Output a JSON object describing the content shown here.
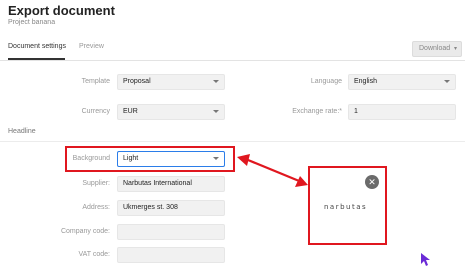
{
  "header": {
    "title": "Export document",
    "subtitle": "Project banana"
  },
  "tabs": [
    {
      "label": "Document settings",
      "active": true
    },
    {
      "label": "Preview",
      "active": false
    }
  ],
  "toolbar": {
    "download_label": "Download",
    "download_caret": "▾"
  },
  "settings": {
    "template": {
      "label": "Template",
      "value": "Proposal"
    },
    "language": {
      "label": "Language",
      "value": "English"
    },
    "currency": {
      "label": "Currency",
      "value": "EUR"
    },
    "exchange_rate": {
      "label": "Exchange rate:*",
      "value": "1"
    }
  },
  "headline": {
    "section_title": "Headline",
    "background": {
      "label": "Background",
      "value": "Light"
    },
    "supplier": {
      "label": "Supplier:",
      "value": "Narbutas International"
    },
    "address": {
      "label": "Address:",
      "value": "Ukmerges st. 308"
    },
    "company_code": {
      "label": "Company code:",
      "value": ""
    },
    "vat_code": {
      "label": "VAT code:",
      "value": ""
    }
  },
  "preview": {
    "logo_text": "narbutas",
    "close_glyph": "✕"
  },
  "colors": {
    "highlight": "#e0171f",
    "focus": "#2b7de9",
    "cursor": "#6b2bd6"
  }
}
